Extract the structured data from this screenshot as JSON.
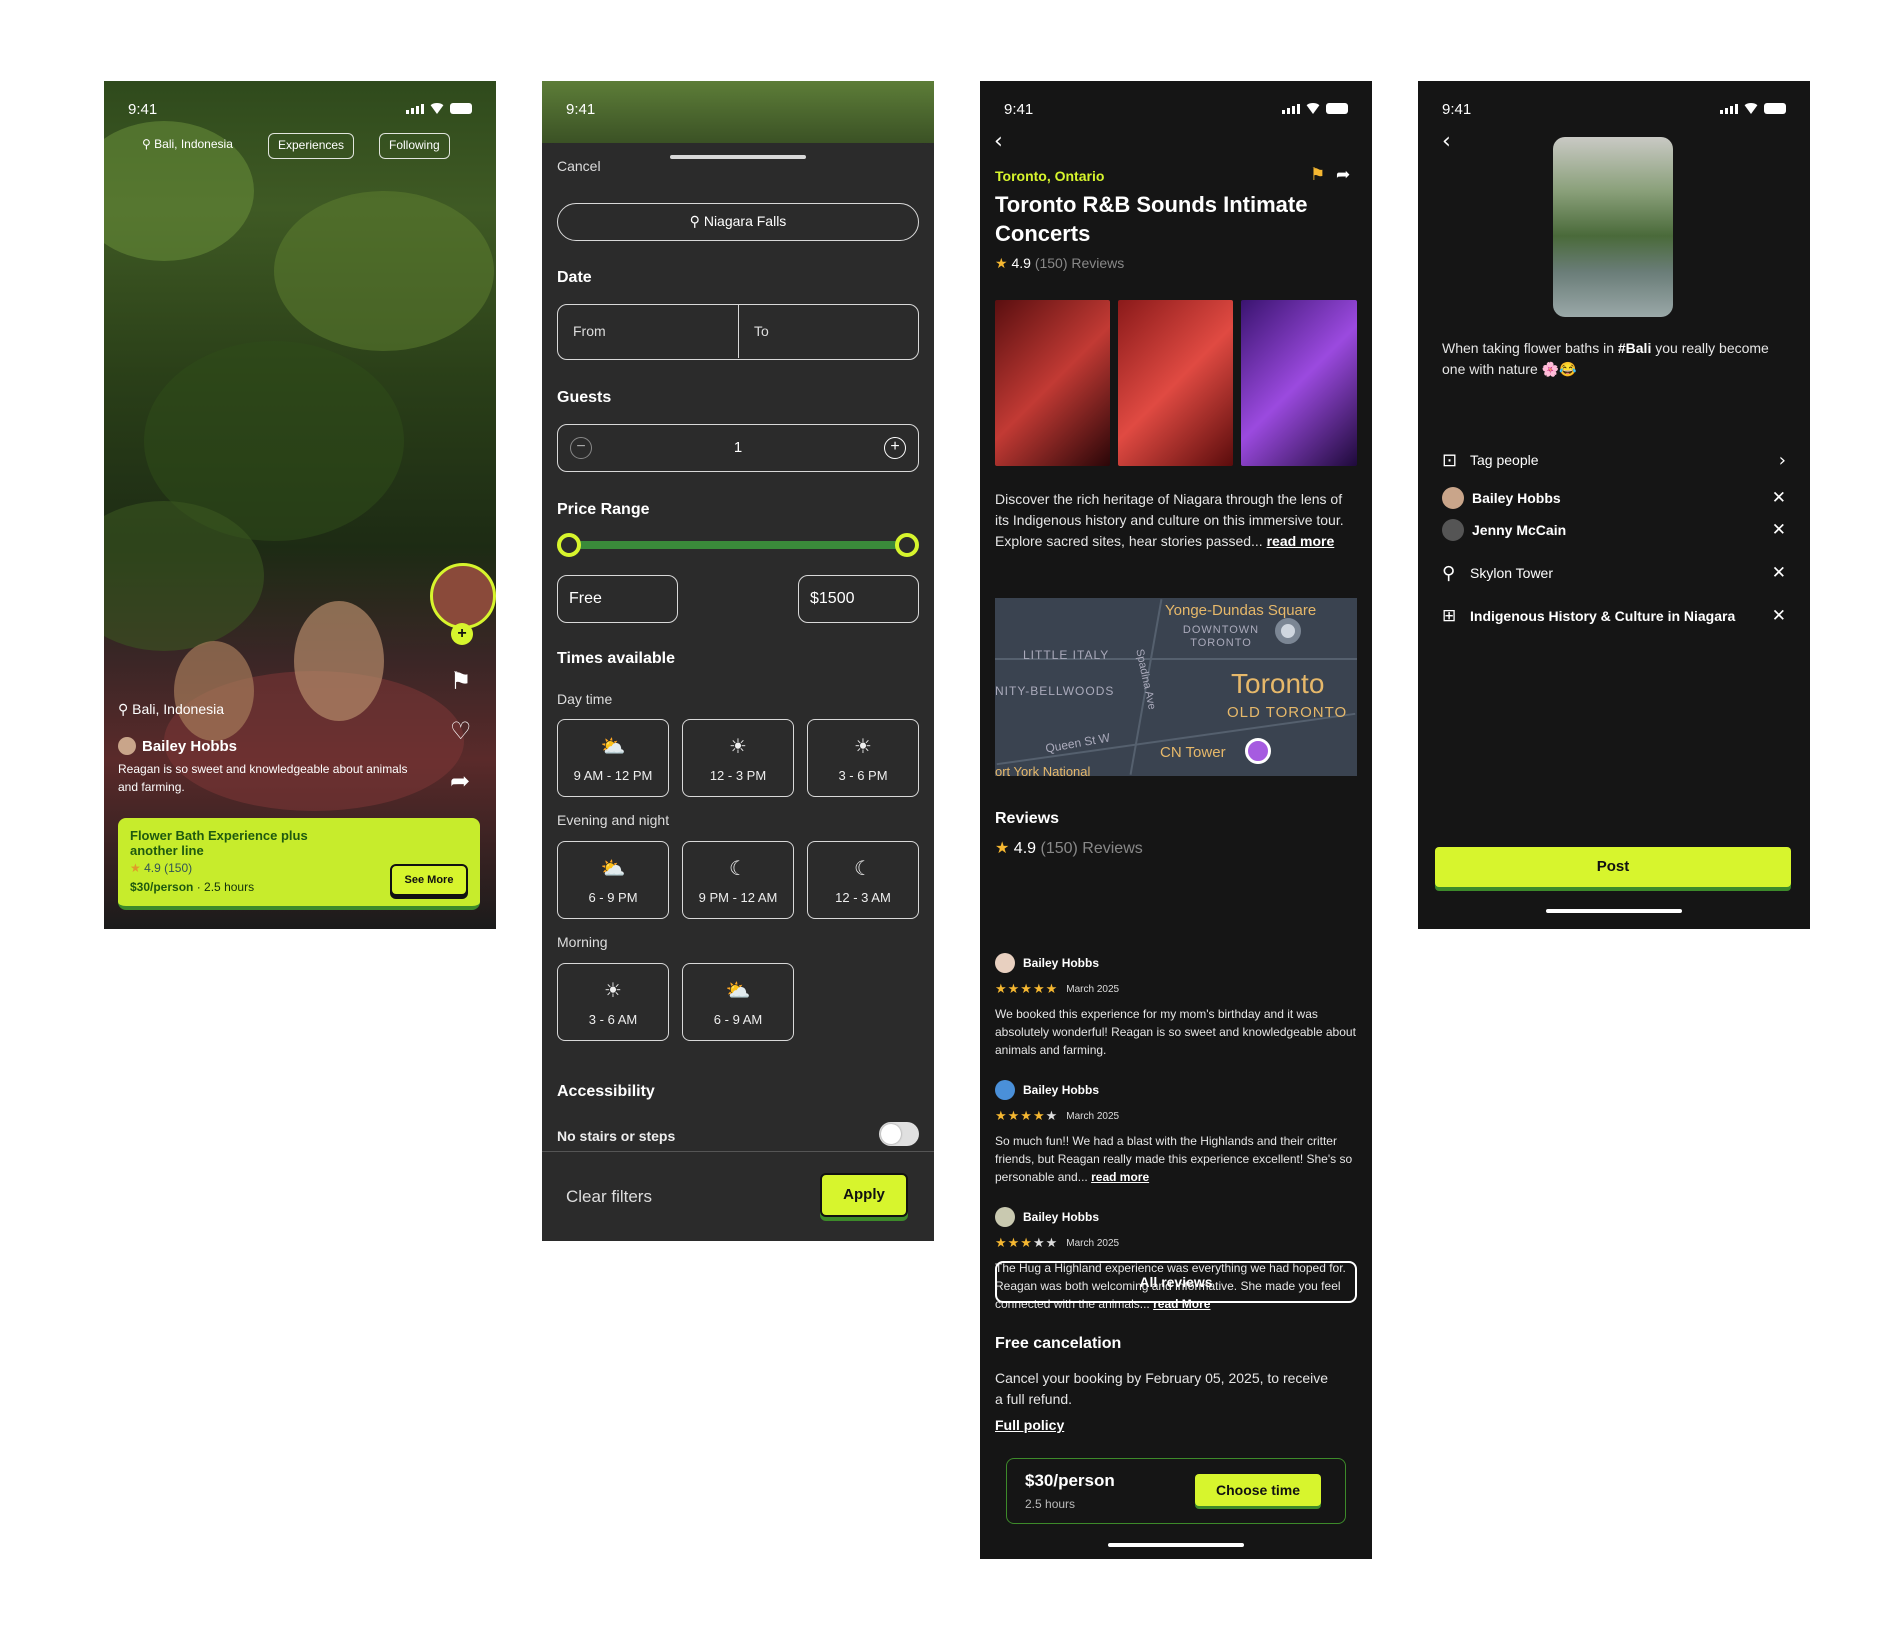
{
  "screen1": {
    "time": "9:41",
    "chips": [
      "Bali, Indonesia",
      "Experiences",
      "Following"
    ],
    "location": "Bali, Indonesia",
    "user": "Bailey Hobbs",
    "caption": "Reagan is so sweet and knowledgeable about animals and farming.",
    "card": {
      "title": "Flower Bath Experience plus another line",
      "rating": "4.9 (150)",
      "price": "$30/person",
      "duration": "2.5 hours",
      "button": "See More"
    }
  },
  "screen2": {
    "time": "9:41",
    "cancel": "Cancel",
    "location": "Niagara Falls",
    "date_label": "Date",
    "from": "From",
    "to": "To",
    "guests_label": "Guests",
    "guests_value": "1",
    "price_label": "Price Range",
    "price_min": "Free",
    "price_max": "$1500",
    "times_label": "Times available",
    "day_label": "Day time",
    "day_slots": [
      "9 AM - 12 PM",
      "12 - 3 PM",
      "3 - 6 PM"
    ],
    "evening_label": "Evening and night",
    "evening_slots": [
      "6 - 9 PM",
      "9 PM - 12 AM",
      "12 - 3 AM"
    ],
    "morning_label": "Morning",
    "morning_slots": [
      "3 - 6 AM",
      "6 - 9 AM"
    ],
    "access_label": "Accessibility",
    "access_option": "No stairs or steps",
    "clear": "Clear  filters",
    "apply": "Apply"
  },
  "screen3": {
    "time": "9:41",
    "location": "Toronto, Ontario",
    "title": "Toronto R&B Sounds Intimate Concerts",
    "rating": "4.9",
    "reviews_count": "(150) Reviews",
    "description": "Discover the rich heritage of Niagara through the lens of its Indigenous history and culture on this immersive tour. Explore sacred sites, hear stories passed...",
    "read_more": "read more",
    "map": {
      "labels": [
        "Yonge-Dundas Square",
        "DOWNTOWN TORONTO",
        "LITTLE ITALY",
        "NITY-BELLWOODS",
        "Toronto",
        "OLD TORONTO",
        "Spadina Ave",
        "Queen St W",
        "CN Tower",
        "ort York National"
      ]
    },
    "reviews_title": "Reviews",
    "reviews_rating": "4.9",
    "reviews_count2": "(150) Reviews",
    "reviews": [
      {
        "name": "Bailey Hobbs",
        "date": "March 2025",
        "stars": 5,
        "text": "We booked this experience for my mom's birthday and it was absolutely wonderful! Reagan is so sweet and knowledgeable about animals and farming.",
        "more": ""
      },
      {
        "name": "Bailey Hobbs",
        "date": "March 2025",
        "stars": 4,
        "text": "So much fun!!  We had a blast with the Highlands and their critter friends, but Reagan really made this experience excellent!  She's so personable and...",
        "more": "read more"
      },
      {
        "name": "Bailey Hobbs",
        "date": "March 2025",
        "stars": 3,
        "text": "The Hug a Highland experience was everything we had hoped for. Reagan was both welcoming and informative. She made you feel connected with the animals...",
        "more": "read More"
      }
    ],
    "all_reviews": "All reviews",
    "cancel_title": "Free cancelation",
    "cancel_text": "Cancel your booking by February 05, 2025, to receive a full refund.",
    "full_policy": "Full policy",
    "price": "$30/person",
    "duration": "2.5 hours",
    "choose": "Choose time"
  },
  "screen4": {
    "time": "9:41",
    "caption_pre": "When taking flower baths in ",
    "caption_tag": "#Bali",
    "caption_post": " you really become one with nature 🌸😂",
    "tag_people": "Tag people",
    "people": [
      "Bailey Hobbs",
      "Jenny McCain"
    ],
    "place": "Skylon Tower",
    "experience": "Indigenous History & Culture in Niagara",
    "post": "Post"
  },
  "colors": {
    "accent": "#d7f52d",
    "accent_green": "#3d8a2a",
    "star": "#f5b731",
    "bg_dark": "#151515",
    "sheet": "#2b2b2b"
  }
}
